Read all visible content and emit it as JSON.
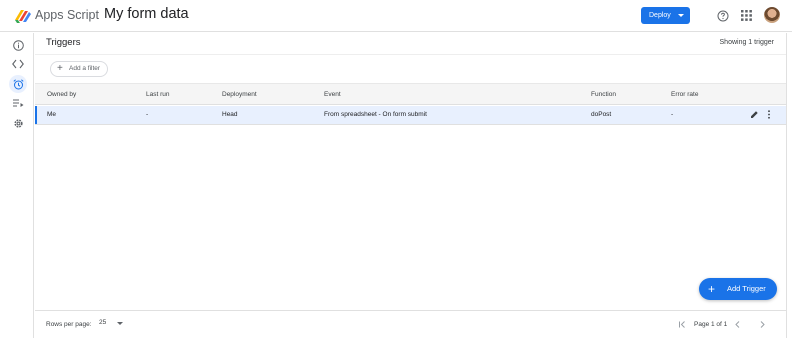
{
  "app": {
    "name": "Apps Script",
    "project_title": "My form data"
  },
  "toolbar": {
    "deploy_label": "Deploy"
  },
  "icons": {
    "logo": "apps-script-logo-icon",
    "help": "help-circle-icon",
    "apps": "apps-grid-icon",
    "avatar": "user-avatar"
  },
  "sidebar": {
    "items": [
      {
        "name": "overview",
        "icon": "info-icon"
      },
      {
        "name": "editor",
        "icon": "code-icon"
      },
      {
        "name": "triggers",
        "icon": "alarm-clock-icon",
        "active": true
      },
      {
        "name": "executions",
        "icon": "executions-list-icon"
      },
      {
        "name": "settings",
        "icon": "gear-icon"
      }
    ]
  },
  "main": {
    "title": "Triggers",
    "showing": "Showing 1 trigger",
    "filter_label": "Add a filter",
    "columns": [
      "Owned by",
      "Last run",
      "Deployment",
      "Event",
      "Function",
      "Error rate"
    ],
    "rows": [
      [
        "Me",
        "-",
        "Head",
        "From spreadsheet - On form submit",
        "doPost",
        "-"
      ]
    ],
    "add_trigger_label": "Add Trigger"
  },
  "footer": {
    "rows_per_page_label": "Rows per page:",
    "rows_per_page_value": "25",
    "page_info": "Page 1 of 1"
  },
  "colors": {
    "accent": "#1a73e8",
    "row_highlight": "#e8f0fe",
    "header_bg": "#f5f5f5"
  }
}
